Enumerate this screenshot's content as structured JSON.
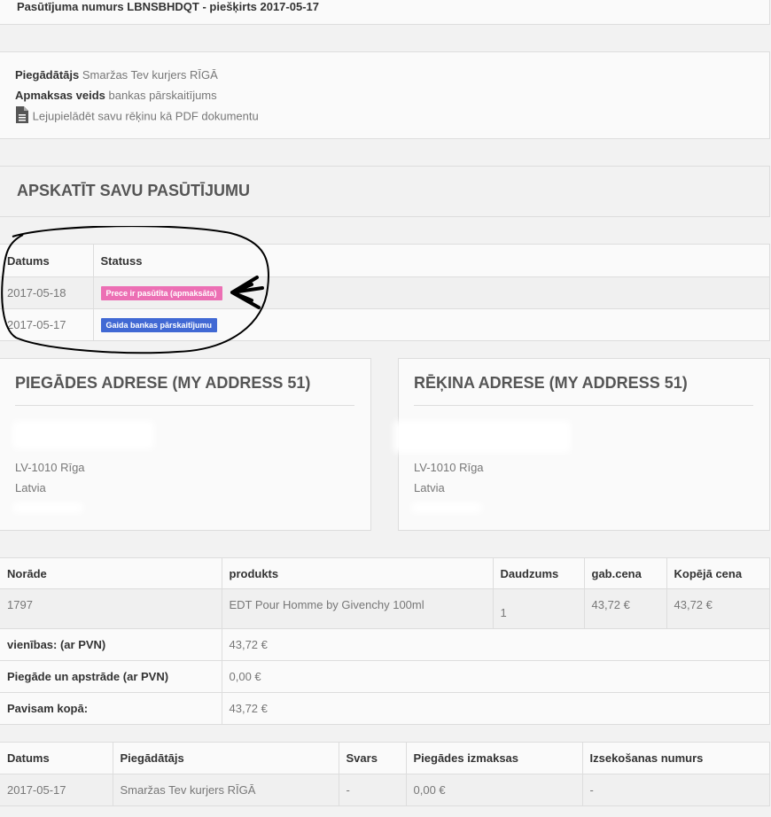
{
  "order": {
    "title": "Pasūtījuma numurs LBNSBHDQT - piešķirts 2017-05-17"
  },
  "info": {
    "supplier_label": "Piegādātājs",
    "supplier_value": "Smaržas Tev kurjers RĪGĀ",
    "payment_label": "Apmaksas veids",
    "payment_value": "bankas pārskaitījums",
    "pdf_link": "Lejupielādēt savu rēķinu kā PDF dokumentu"
  },
  "view_order": {
    "heading": "APSKATĪT SAVU PASŪTĪJUMU"
  },
  "status_table": {
    "headers": [
      "Datums",
      "Statuss"
    ],
    "rows": [
      {
        "date": "2017-05-18",
        "status": "Prece ir pasūtīta (apmaksāta)",
        "color": "#ec6fb4"
      },
      {
        "date": "2017-05-17",
        "status": "Gaida bankas pārskaitījumu",
        "color": "#4169d4"
      }
    ]
  },
  "delivery_address": {
    "heading": "PIEGĀDES ADRESE (MY ADDRESS 51)",
    "city": "LV-1010 Rīga",
    "country": "Latvia"
  },
  "billing_address": {
    "heading": "RĒĶINA ADRESE (MY ADDRESS 51)",
    "city": "LV-1010 Rīga",
    "country": "Latvia"
  },
  "products_table": {
    "headers": [
      "Norāde",
      "produkts",
      "Daudzums",
      "gab.cena",
      "Kopējā cena"
    ],
    "row": {
      "ref": "1797",
      "product": "EDT Pour Homme by Givenchy 100ml",
      "qty": "1",
      "unit_price": "43,72 €",
      "total": "43,72 €"
    },
    "totals": [
      {
        "label": "vienības: (ar PVN)",
        "value": "43,72 €"
      },
      {
        "label": "Piegāde un apstrāde (ar PVN)",
        "value": "0,00 €"
      },
      {
        "label": "Pavisam kopā:",
        "value": "43,72 €"
      }
    ]
  },
  "shipping_table": {
    "headers": [
      "Datums",
      "Piegādātājs",
      "Svars",
      "Piegādes izmaksas",
      "Izsekošanas numurs"
    ],
    "row": {
      "date": "2017-05-17",
      "carrier": "Smaržas Tev kurjers RĪGĀ",
      "weight": "-",
      "cost": "0,00 €",
      "tracking": "-"
    }
  },
  "colors": {
    "pink_badge": "#ec6fb4",
    "blue_badge": "#4169d4",
    "annotation": "#000000"
  }
}
